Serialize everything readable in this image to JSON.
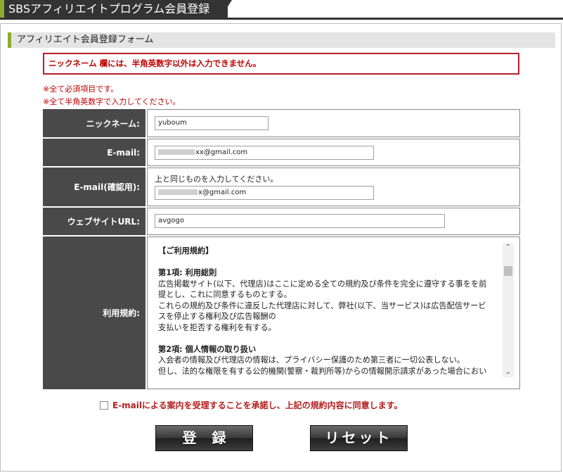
{
  "header": {
    "title": "SBSアフィリエイトプログラム会員登録"
  },
  "section": {
    "title": "アフィリエイト会員登録フォーム"
  },
  "error": {
    "message": "ニックネーム 欄には、半角英数字以外は入力できません。"
  },
  "notes": [
    "※全て必須項目です。",
    "※全て半角英数字で入力してください。"
  ],
  "form": {
    "nickname": {
      "label": "ニックネーム:",
      "value": "yuboum"
    },
    "email": {
      "label": "E-mail:",
      "value": "xx@gmail.com"
    },
    "email_confirm": {
      "label": "E-mail(確認用):",
      "hint": "上と同じものを入力してください。",
      "value": "x@gmail.com"
    },
    "website": {
      "label": "ウェブサイトURL:",
      "value": "avgogo"
    },
    "terms": {
      "label": "利用規約:",
      "lines": [
        "【ご利用規約】",
        "",
        "第1項: 利用総則",
        "広告掲載サイト(以下、代理店)はここに定める全ての規約及び条件を完全に遵守する事をを前",
        "提とし、これに同意するものとする。",
        "これらの規約及び条件に違反した代理店に対して、弊社(以下、当サービス)は広告配信サービ",
        "スを停止する権利及び広告報酬の",
        "支払いを拒否する権利を有する。",
        "",
        "第2項: 個人情報の取り扱い",
        "入会者の情報及び代理店の情報は、プライバシー保護のため第三者に一切公表しない。",
        "但し、法的な権限を有する公的機関(警察・裁判所等)からの情報開示請求があった場合におい"
      ]
    }
  },
  "consent": {
    "label": "E-mailによる案内を受理することを承諾し、上記の規約内容に同意します。",
    "checked": false
  },
  "buttons": {
    "register": "登録",
    "reset": "リセット"
  }
}
